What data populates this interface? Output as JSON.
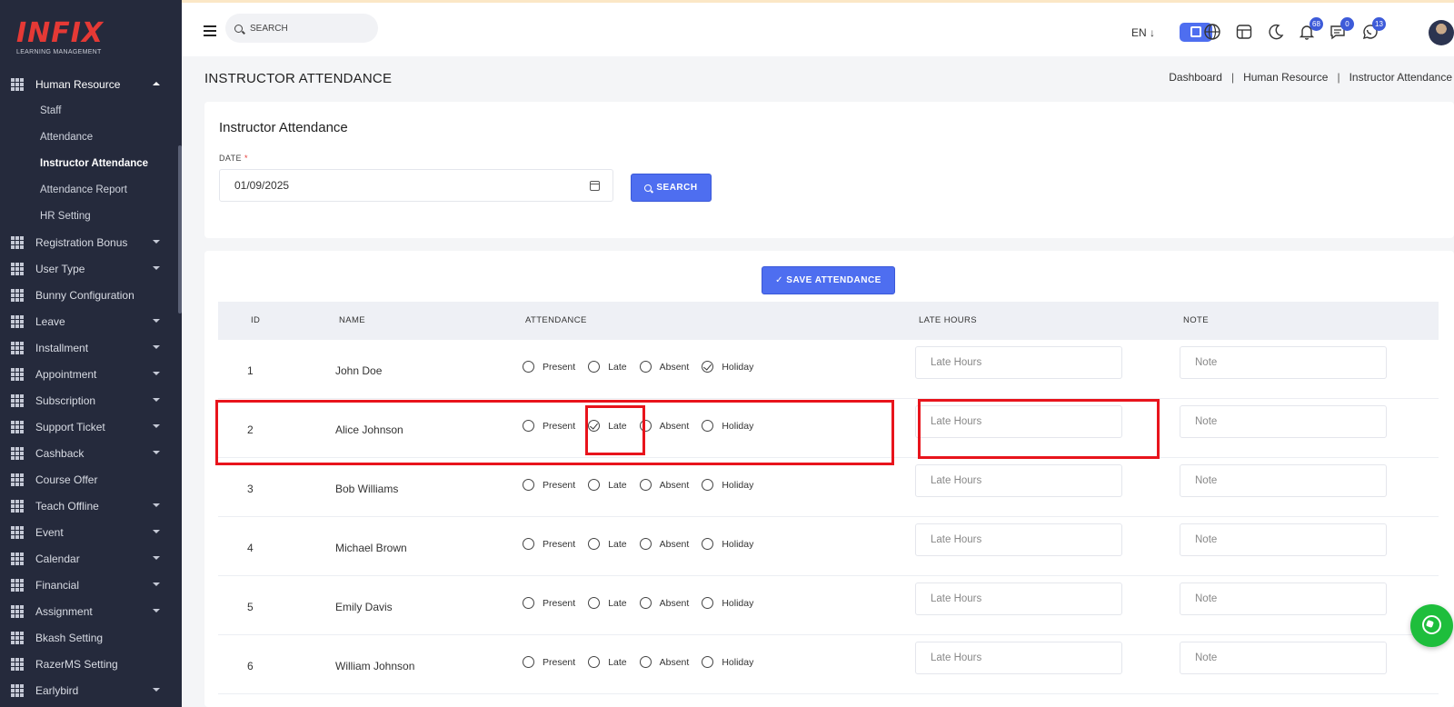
{
  "app": {
    "brand": "INFIX",
    "tagline": "LEARNING MANAGEMENT"
  },
  "sidebar": {
    "open_section": "Human Resource",
    "sub_items": [
      "Staff",
      "Attendance",
      "Instructor Attendance",
      "Attendance Report",
      "HR Setting"
    ],
    "active_sub_item": "Instructor Attendance",
    "items": [
      {
        "label": "Registration Bonus",
        "caret": true
      },
      {
        "label": "User Type",
        "caret": true
      },
      {
        "label": "Bunny Configuration",
        "caret": false
      },
      {
        "label": "Leave",
        "caret": true
      },
      {
        "label": "Installment",
        "caret": true
      },
      {
        "label": "Appointment",
        "caret": true
      },
      {
        "label": "Subscription",
        "caret": true
      },
      {
        "label": "Support Ticket",
        "caret": true
      },
      {
        "label": "Cashback",
        "caret": true
      },
      {
        "label": "Course Offer",
        "caret": false
      },
      {
        "label": "Teach Offline",
        "caret": true
      },
      {
        "label": "Event",
        "caret": true
      },
      {
        "label": "Calendar",
        "caret": true
      },
      {
        "label": "Financial",
        "caret": true
      },
      {
        "label": "Assignment",
        "caret": true
      },
      {
        "label": "Bkash Setting",
        "caret": false
      },
      {
        "label": "RazerMS Setting",
        "caret": false
      },
      {
        "label": "Earlybird",
        "caret": true
      }
    ]
  },
  "header": {
    "search_placeholder": "SEARCH",
    "language": "EN ↓",
    "notifications_count": "68",
    "messages_count": "0",
    "whatsapp_count": "13",
    "icons": [
      "chip-icon",
      "globe-icon",
      "layout-icon",
      "moon-icon",
      "bell-icon",
      "chat-icon",
      "whatsapp-icon"
    ]
  },
  "page": {
    "title": "INSTRUCTOR ATTENDANCE",
    "breadcrumb": [
      "Dashboard",
      "Human Resource",
      "Instructor Attendance"
    ]
  },
  "search_card": {
    "title": "Instructor Attendance",
    "date_label": "DATE",
    "required_mark": "*",
    "date_value": "01/09/2025",
    "search_button": "SEARCH"
  },
  "table": {
    "save_button": "✓ SAVE ATTENDANCE",
    "headers": {
      "id": "ID",
      "name": "NAME",
      "attendance": "ATTENDANCE",
      "late_hours": "LATE HOURS",
      "note": "NOTE"
    },
    "options": [
      "Present",
      "Late",
      "Absent",
      "Holiday"
    ],
    "late_placeholder": "Late Hours",
    "note_placeholder": "Note",
    "rows": [
      {
        "id": "1",
        "name": "John Doe",
        "selected": "Holiday"
      },
      {
        "id": "2",
        "name": "Alice Johnson",
        "selected": "Late"
      },
      {
        "id": "3",
        "name": "Bob Williams",
        "selected": ""
      },
      {
        "id": "4",
        "name": "Michael Brown",
        "selected": ""
      },
      {
        "id": "5",
        "name": "Emily Davis",
        "selected": ""
      },
      {
        "id": "6",
        "name": "William Johnson",
        "selected": ""
      }
    ]
  },
  "colors": {
    "sidebar_bg": "#252a3c",
    "accent": "#4e6ef0",
    "brand_red": "#e53935",
    "highlight": "#e8141c",
    "whatsapp": "#1ebe3c"
  }
}
